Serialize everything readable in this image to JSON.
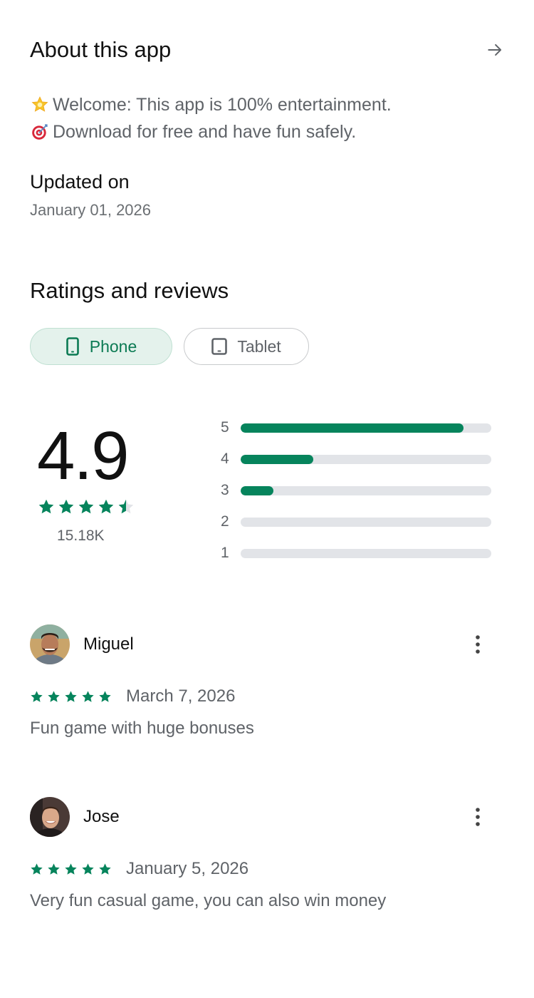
{
  "about": {
    "title": "About this app",
    "arrow_icon": "arrow-right-icon",
    "lines": [
      {
        "emoji": "star-emoji",
        "text": "Welcome: This app is 100% entertainment."
      },
      {
        "emoji": "target-emoji",
        "text": "Download for free and have fun safely."
      }
    ]
  },
  "updated": {
    "title": "Updated on",
    "date": "January 01, 2026"
  },
  "ratings": {
    "title": "Ratings and reviews",
    "chips": [
      {
        "label": "Phone",
        "icon": "phone-icon",
        "selected": true
      },
      {
        "label": "Tablet",
        "icon": "tablet-icon",
        "selected": false
      }
    ],
    "score": "4.9",
    "stars_value": 4.5,
    "count": "15.18K",
    "bars": [
      {
        "label": "5",
        "fraction": 0.89
      },
      {
        "label": "4",
        "fraction": 0.29
      },
      {
        "label": "3",
        "fraction": 0.13
      },
      {
        "label": "2",
        "fraction": 0.0
      },
      {
        "label": "1",
        "fraction": 0.0
      }
    ],
    "accent_color": "#06845c",
    "track_color": "#e2e4e8"
  },
  "reviews": [
    {
      "name": "Miguel",
      "stars": 5,
      "date": "March 7, 2026",
      "text": "Fun game with huge bonuses"
    },
    {
      "name": "Jose",
      "stars": 5,
      "date": "January 5, 2026",
      "text": "Very fun casual game, you can also win money"
    }
  ]
}
